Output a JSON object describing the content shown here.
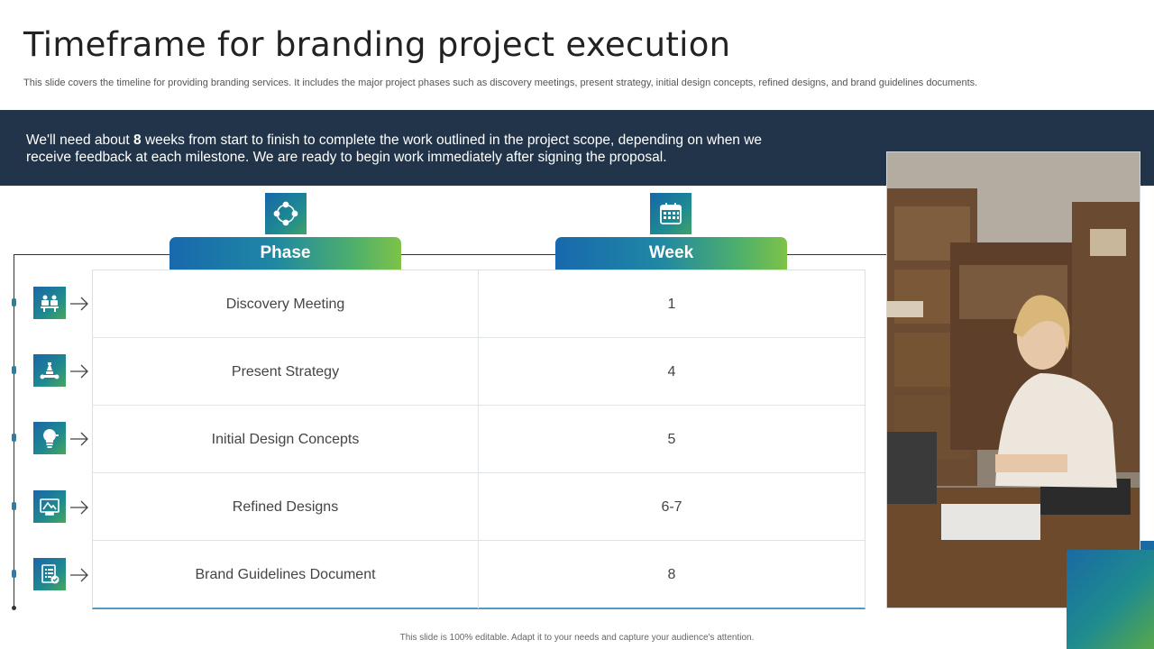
{
  "slide": {
    "title": "Timeframe for branding project execution",
    "subtitle": "This slide covers the timeline for providing branding services. It includes the major project phases such as discovery meetings, present strategy, initial design concepts, refined designs, and brand guidelines documents."
  },
  "banner": {
    "text_before": "We'll need about ",
    "highlight": "8",
    "text_after": " weeks from start to finish to complete the work outlined in the project scope, depending on when we receive feedback at each milestone. We are ready to begin work immediately after signing the proposal."
  },
  "table": {
    "headers": {
      "phase": "Phase",
      "week": "Week"
    },
    "header_icons": {
      "phase": "process-cycle-icon",
      "week": "calendar-icon"
    },
    "rows": [
      {
        "phase": "Discovery Meeting",
        "week": "1",
        "icon": "meeting-icon"
      },
      {
        "phase": "Present Strategy",
        "week": "4",
        "icon": "strategy-chess-icon"
      },
      {
        "phase": "Initial Design Concepts",
        "week": "5",
        "icon": "idea-bulb-icon"
      },
      {
        "phase": "Refined Designs",
        "week": "6-7",
        "icon": "design-drawing-icon"
      },
      {
        "phase": "Brand Guidelines Document",
        "week": "8",
        "icon": "checklist-document-icon"
      }
    ]
  },
  "footer": {
    "text": "This slide is 100% editable. Adapt it to your needs and capture your audience's attention."
  },
  "colors": {
    "banner_bg": "#22344a",
    "accent_blue": "#1869ad",
    "accent_green": "#7ec248"
  }
}
